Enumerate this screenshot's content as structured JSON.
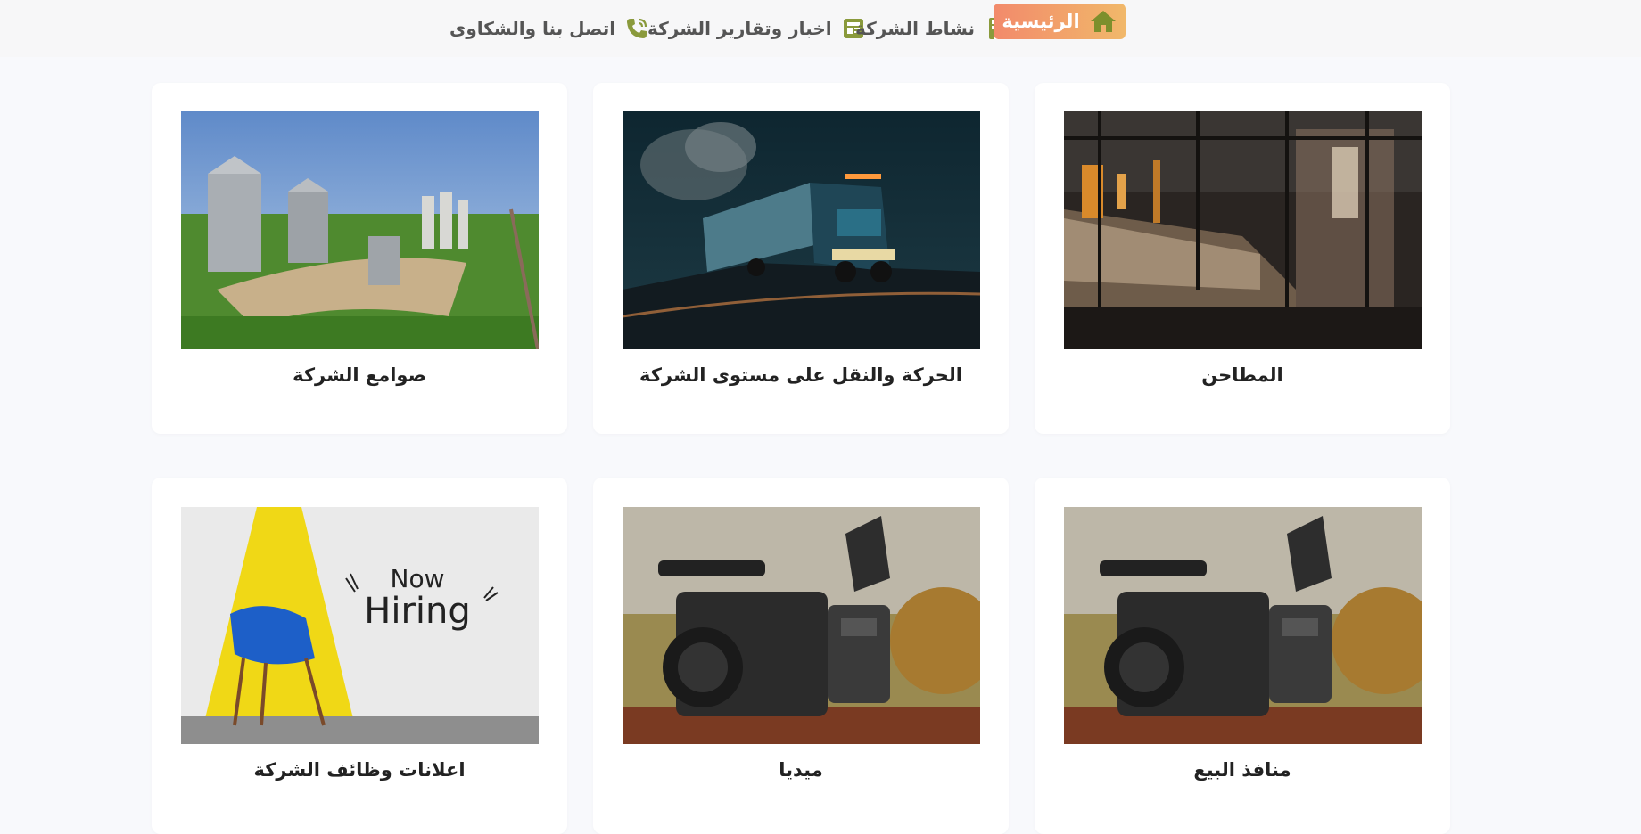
{
  "nav": {
    "home": "الرئيسية",
    "activity": "نشاط الشركة",
    "news": "اخبار وتقارير الشركة",
    "contact": "اتصل بنا والشكاوى"
  },
  "cards": [
    {
      "title": "المطاحن",
      "image": "mill-interior-photo"
    },
    {
      "title": "الحركة والنقل على مستوى الشركة",
      "image": "truck-night-photo"
    },
    {
      "title": "صوامع الشركة",
      "image": "grain-silos-photo"
    },
    {
      "title": "منافذ البيع",
      "image": "video-camera-photo"
    },
    {
      "title": "ميديا",
      "image": "video-camera-photo"
    },
    {
      "title": "اعلانات وظائف الشركة",
      "image": "now-hiring-photo",
      "image_text": [
        "Now",
        "Hiring"
      ]
    }
  ],
  "colors": {
    "home_gradient_start": "#f28a6b",
    "home_gradient_end": "#f1b86a",
    "icon_green": "#8a9a3c",
    "nav_text": "#555555"
  }
}
